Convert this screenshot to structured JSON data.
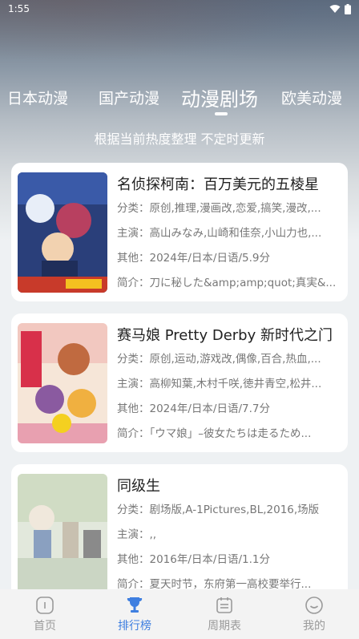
{
  "status": {
    "time": "1:55"
  },
  "tabs": [
    "日本动漫",
    "国产动漫",
    "动漫剧场",
    "欧美动漫"
  ],
  "subtitle": "根据当前热度整理 不定时更新",
  "labels": {
    "category": "分类：",
    "cast": "主演：",
    "other": "其他：",
    "intro": "简介："
  },
  "items": [
    {
      "title": "名侦探柯南：百万美元的五棱星",
      "category": "原创,推理,漫画改,恋爱,搞笑,漫改,...",
      "cast": "高山みなみ,山崎和佳奈,小山力也,...",
      "other": "2024年/日本/日语/5.9分",
      "intro": "刀に秘した&amp;amp;quot;真実&..."
    },
    {
      "title": "赛马娘 Pretty Derby 新时代之门",
      "category": "原创,运动,游戏改,偶像,百合,热血,...",
      "cast": "高柳知葉,木村千咲,徳井青空,松井...",
      "other": "2024年/日本/日语/7.7分",
      "intro": "「ウマ娘」–彼女たちは走るため..."
    },
    {
      "title": "同级生",
      "category": "剧场版,A-1Pictures,BL,2016,场版",
      "cast": ",,",
      "other": "2016年/日本/日语/1.1分",
      "intro": "夏天时节，东府第一高校要举行..."
    }
  ],
  "nav": [
    "首页",
    "排行榜",
    "周期表",
    "我的"
  ],
  "colors": {
    "accent": "#3f7fe0",
    "nav_inactive": "#9a9a9a"
  }
}
